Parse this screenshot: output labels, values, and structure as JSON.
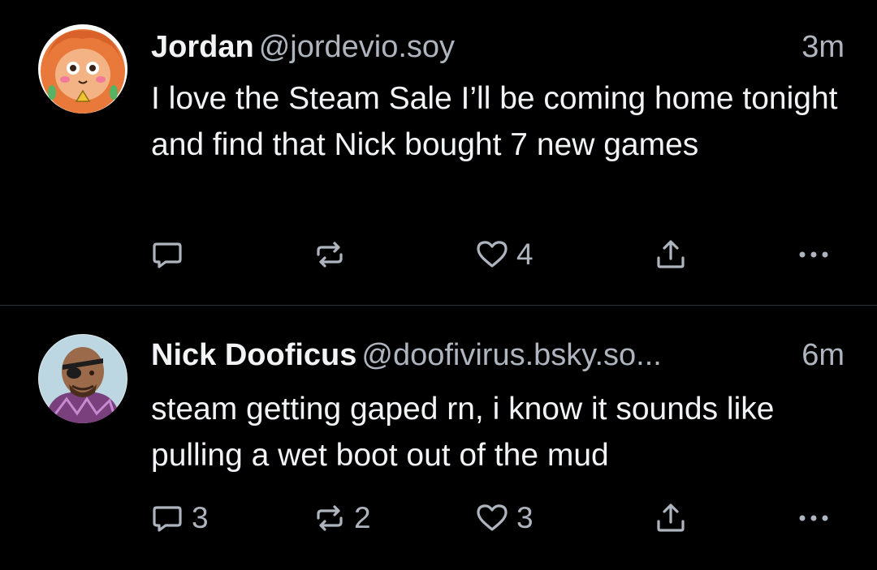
{
  "posts": [
    {
      "display_name": "Jordan",
      "handle": "@jordevio.soy",
      "time": "3m",
      "text": "I love the Steam Sale I’ll be coming home tonight and find that Nick bought 7 new games",
      "actions": {
        "reply_count": "",
        "repost_count": "",
        "like_count": "4"
      }
    },
    {
      "display_name": "Nick Dooficus",
      "handle": "@doofivirus.bsky.so...",
      "time": "6m",
      "text": "steam getting gaped rn, i know it sounds like pulling a wet boot out of the mud",
      "actions": {
        "reply_count": "3",
        "repost_count": "2",
        "like_count": "3"
      }
    }
  ],
  "icons": {
    "reply": "speech-bubble-icon",
    "repost": "repost-arrows-icon",
    "like": "heart-icon",
    "share": "share-upload-icon",
    "more": "ellipsis-icon"
  },
  "colors": {
    "background": "#000000",
    "primary_text": "#f1f3f5",
    "secondary_text": "#aeb5bf",
    "divider": "#2e3338"
  }
}
